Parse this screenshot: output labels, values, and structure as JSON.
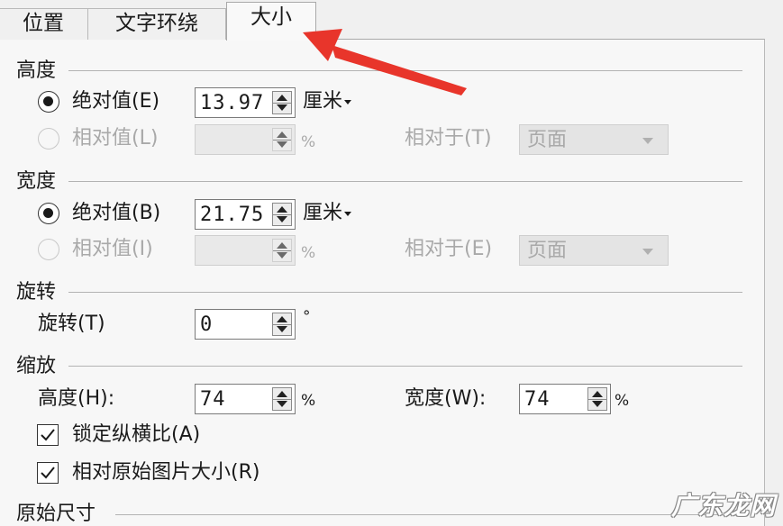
{
  "tabs": [
    {
      "label": "位置",
      "active": false
    },
    {
      "label": "文字环绕",
      "active": false
    },
    {
      "label": "大小",
      "active": true
    }
  ],
  "height_section": {
    "title": "高度",
    "absolute": {
      "label": "绝对值(E)",
      "value": "13.97",
      "unit": "厘米",
      "selected": true
    },
    "relative": {
      "label": "相对值(L)",
      "value": "",
      "unit": "%",
      "relative_to_label": "相对于(T)",
      "relative_to_value": "页面",
      "enabled": false
    }
  },
  "width_section": {
    "title": "宽度",
    "absolute": {
      "label": "绝对值(B)",
      "value": "21.75",
      "unit": "厘米",
      "selected": true
    },
    "relative": {
      "label": "相对值(I)",
      "value": "",
      "unit": "%",
      "relative_to_label": "相对于(E)",
      "relative_to_value": "页面",
      "enabled": false
    }
  },
  "rotation_section": {
    "title": "旋转",
    "label": "旋转(T)",
    "value": "0",
    "unit": "°"
  },
  "scale_section": {
    "title": "缩放",
    "height_label": "高度(H):",
    "height_value": "74",
    "height_unit": "%",
    "width_label": "宽度(W):",
    "width_value": "74",
    "width_unit": "%",
    "lock_aspect": {
      "label": "锁定纵横比(A)",
      "checked": true
    },
    "relative_original": {
      "label": "相对原始图片大小(R)",
      "checked": true
    }
  },
  "original_size_section": {
    "title": "原始尺寸"
  },
  "colors": {
    "annotation_arrow": "#e8352b",
    "panel_background": "#f7f7f7"
  },
  "watermark": "广东龙网"
}
